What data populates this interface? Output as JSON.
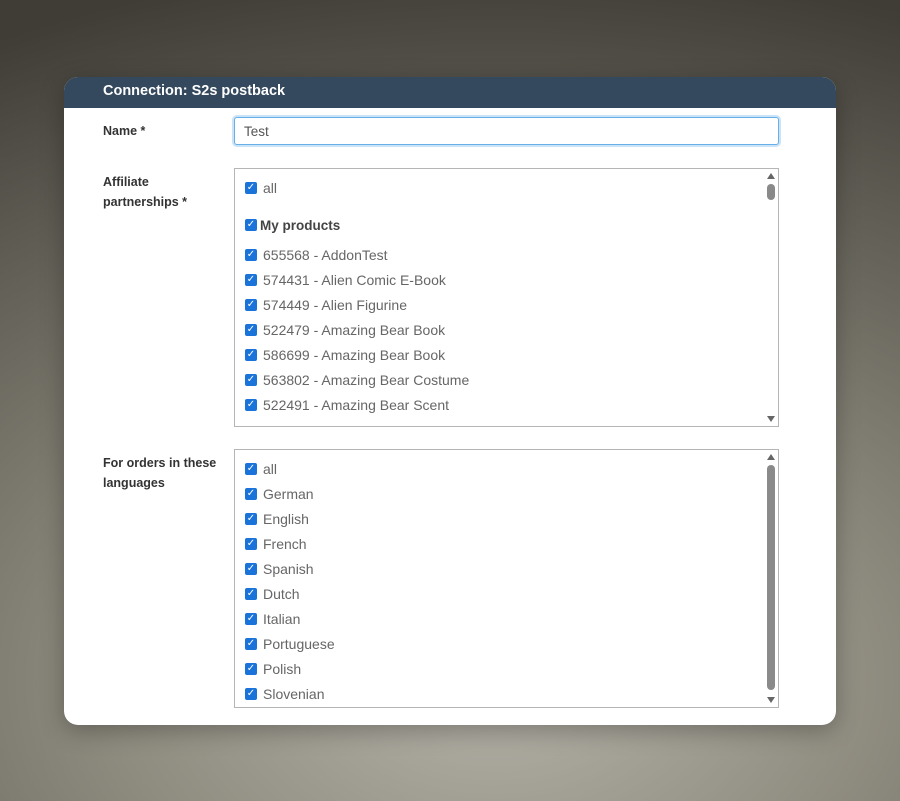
{
  "dialog": {
    "title": "Connection: S2s postback"
  },
  "name_field": {
    "label": "Name *",
    "value": "Test"
  },
  "affiliate_field": {
    "label_line1": "Affiliate",
    "label_line2": "partnerships *",
    "all_label": "all",
    "group_label": "My products",
    "items": [
      {
        "label": "655568 - AddonTest",
        "checked": true
      },
      {
        "label": "574431 - Alien Comic E-Book",
        "checked": true
      },
      {
        "label": "574449 - Alien Figurine",
        "checked": true
      },
      {
        "label": "522479 - Amazing Bear Book",
        "checked": true
      },
      {
        "label": "586699 - Amazing Bear Book",
        "checked": true
      },
      {
        "label": "563802 - Amazing Bear Costume",
        "checked": true
      },
      {
        "label": "522491 - Amazing Bear Scent",
        "checked": true
      }
    ]
  },
  "languages_field": {
    "label_line1": "For orders in these",
    "label_line2": "languages",
    "items": [
      {
        "label": "all",
        "checked": true
      },
      {
        "label": "German",
        "checked": true
      },
      {
        "label": "English",
        "checked": true
      },
      {
        "label": "French",
        "checked": true
      },
      {
        "label": "Spanish",
        "checked": true
      },
      {
        "label": "Dutch",
        "checked": true
      },
      {
        "label": "Italian",
        "checked": true
      },
      {
        "label": "Portuguese",
        "checked": true
      },
      {
        "label": "Polish",
        "checked": true
      },
      {
        "label": "Slovenian",
        "checked": true
      }
    ]
  },
  "colors": {
    "header_bg": "#34495e",
    "checkbox_accent": "#1a73d9",
    "input_focus": "#66afe9"
  },
  "icons": {
    "checkbox": "checkbox-checked-icon",
    "scroll_up": "arrow-up-icon",
    "scroll_down": "arrow-down-icon"
  }
}
